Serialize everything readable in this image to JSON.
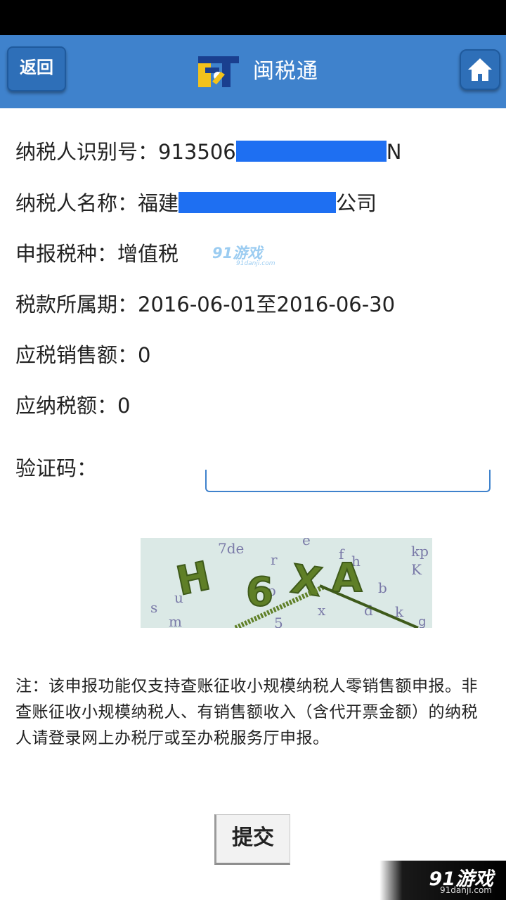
{
  "header": {
    "back_label": "返回",
    "title": "闽税通",
    "logo_icon": "mst-logo-icon",
    "home_icon": "home-icon"
  },
  "fields": {
    "taxpayer_id_label": "纳税人识别号：",
    "taxpayer_id_prefix": "913506",
    "taxpayer_id_suffix": "N",
    "taxpayer_name_label": "纳税人名称：",
    "taxpayer_name_prefix": "福建",
    "taxpayer_name_suffix": "公司",
    "tax_type_label": "申报税种：",
    "tax_type_value": "增值税",
    "period_label": "税款所属期：",
    "period_value": "2016-06-01至2016-06-30",
    "taxable_sales_label": "应税销售额：",
    "taxable_sales_value": "0",
    "tax_payable_label": "应纳税额：",
    "tax_payable_value": "0",
    "captcha_label": "验证码：",
    "captcha_input_value": "",
    "captcha_text": "H6XA"
  },
  "note": "注：该申报功能仅支持查账征收小规模纳税人零销售额申报。非查账征收小规模纳税人、有销售额收入（含代开票金额）的纳税人请登录网上办税厅或至办税服务厅申报。",
  "submit_label": "提交",
  "watermark": {
    "mid_brand": "91游戏",
    "mid_url": "91danji.com",
    "corner_brand": "91游戏",
    "corner_url": "91danji.com"
  },
  "colors": {
    "header_bg": "#3f82cc",
    "redaction": "#1e6ff2",
    "input_border": "#3f82cc"
  }
}
